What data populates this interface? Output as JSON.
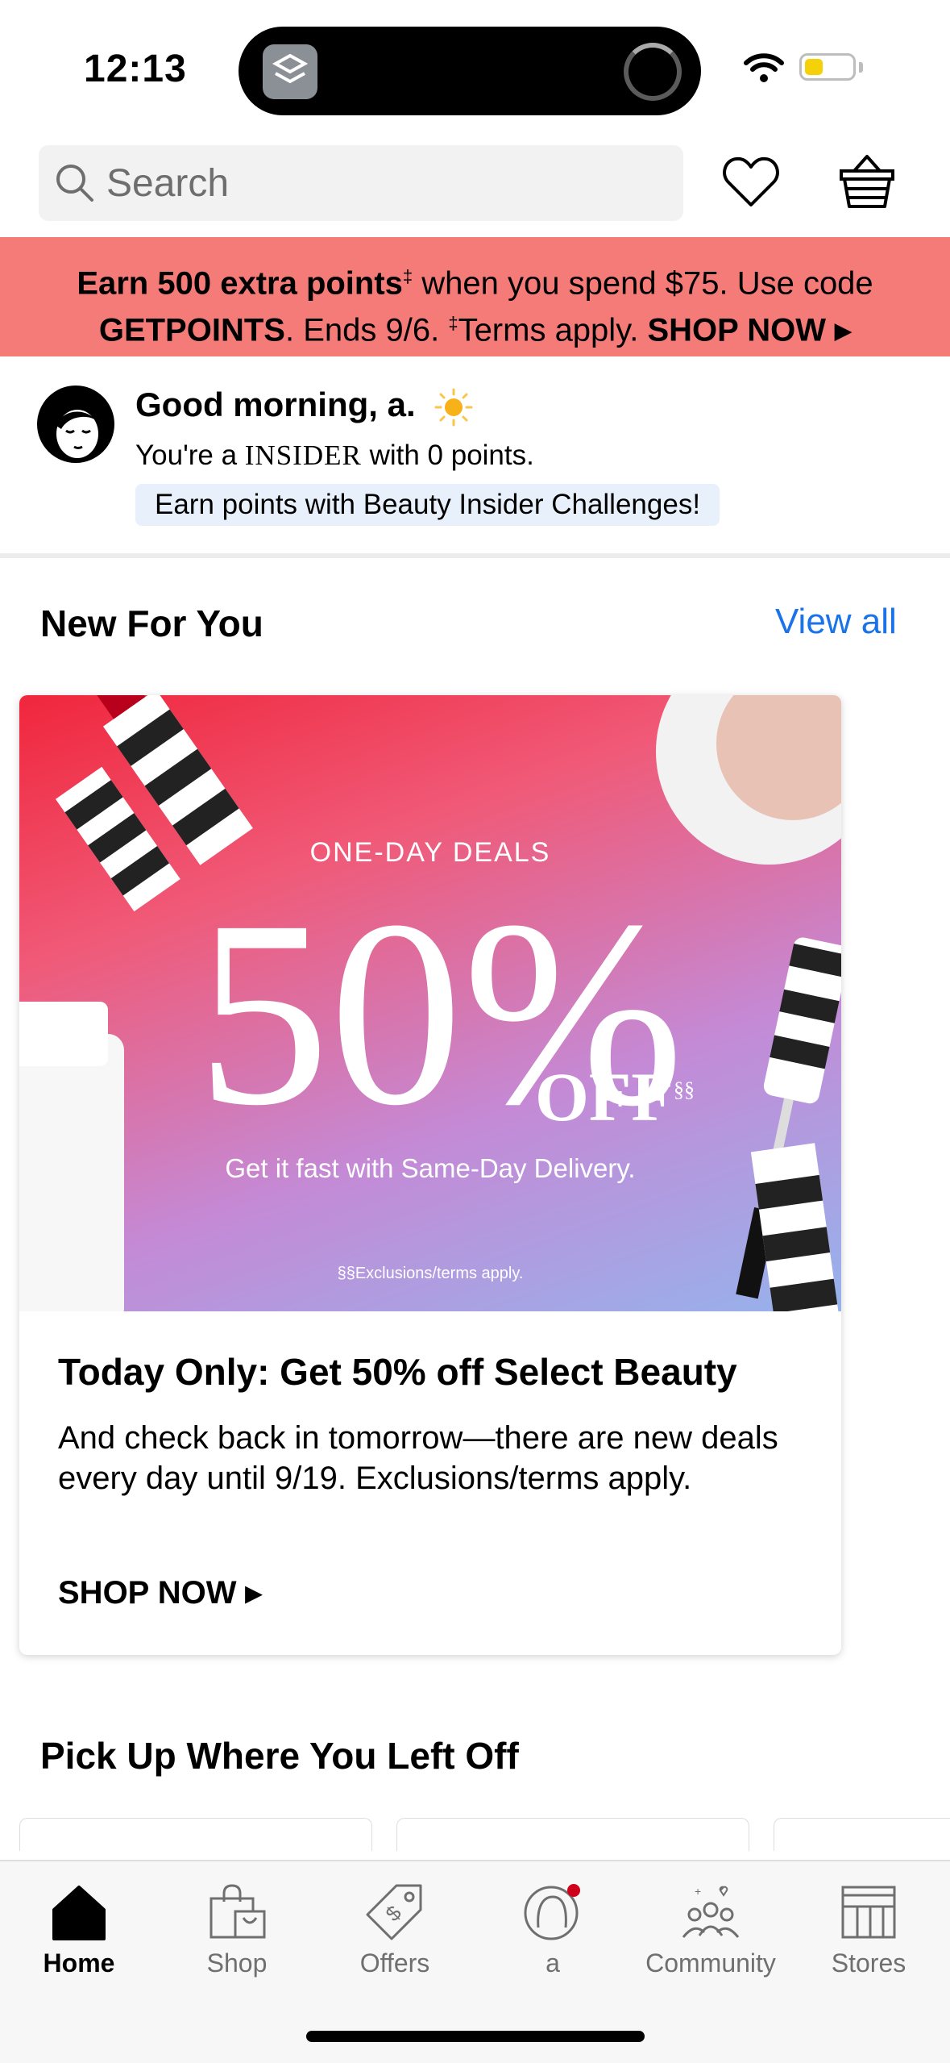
{
  "status_bar": {
    "time": "12:13"
  },
  "search": {
    "placeholder": "Search"
  },
  "promo": {
    "bold_lead": "Earn 500 extra points",
    "mark": "‡",
    "text_a": " when you spend $75. Use code",
    "code": "GETPOINTS",
    "text_b": ". Ends 9/6. ",
    "terms": "Terms apply.",
    "cta": "SHOP NOW ▸"
  },
  "greeting": {
    "title": "Good morning, a.",
    "insider_prefix": "You're a ",
    "insider_word": "INSIDER",
    "insider_suffix": " with 0 points.",
    "challenge": "Earn points with Beauty Insider Challenges!"
  },
  "new_for_you": {
    "heading": "New For You",
    "view_all": "View all",
    "card": {
      "image_label": "ONE-DAY DEALS",
      "image_percent": "50%",
      "image_off": "OFF",
      "image_off_mark": "§§",
      "image_sub": "Get it fast with Same-Day Delivery.",
      "image_exclusions": "§§Exclusions/terms apply.",
      "title": "Today Only: Get 50% off Select Beauty",
      "body": "And check back in tomorrow—there are new deals every day until 9/19. Exclusions/terms apply.",
      "cta": "SHOP NOW ▸"
    }
  },
  "pickup": {
    "heading": "Pick Up Where You Left Off"
  },
  "tabs": [
    {
      "label": "Home",
      "icon": "home-icon",
      "active": true
    },
    {
      "label": "Shop",
      "icon": "shopping-bag-icon"
    },
    {
      "label": "Offers",
      "icon": "tag-icon"
    },
    {
      "label": "a",
      "icon": "profile-icon"
    },
    {
      "label": "Community",
      "icon": "community-icon"
    },
    {
      "label": "Stores",
      "icon": "store-icon"
    }
  ],
  "colors": {
    "promo_bg": "#f47b78",
    "link": "#1a73e8",
    "notification_dot": "#d0021b"
  }
}
